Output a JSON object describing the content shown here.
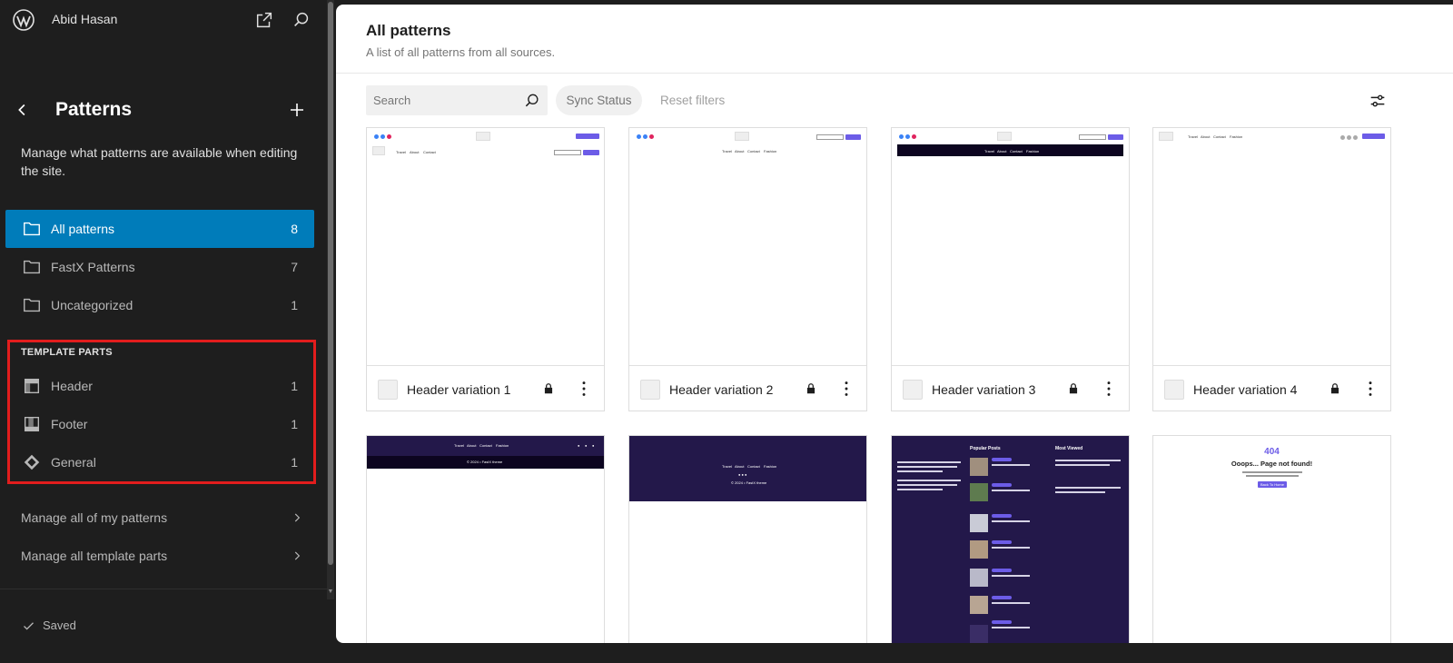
{
  "site": {
    "name": "Abid Hasan"
  },
  "sidebar": {
    "title": "Patterns",
    "description": "Manage what patterns are available when editing the site.",
    "nav": [
      {
        "label": "All patterns",
        "count": "8"
      },
      {
        "label": "FastX Patterns",
        "count": "7"
      },
      {
        "label": "Uncategorized",
        "count": "1"
      }
    ],
    "template_parts": {
      "heading": "TEMPLATE PARTS",
      "items": [
        {
          "label": "Header",
          "count": "1"
        },
        {
          "label": "Footer",
          "count": "1"
        },
        {
          "label": "General",
          "count": "1"
        }
      ]
    },
    "links": [
      {
        "label": "Manage all of my patterns"
      },
      {
        "label": "Manage all template parts"
      }
    ],
    "status": "Saved"
  },
  "main": {
    "title": "All patterns",
    "subtitle": "A list of all patterns from all sources.",
    "search_placeholder": "Search",
    "sync_status": "Sync Status",
    "reset": "Reset filters",
    "cards": [
      {
        "name": "Header variation 1"
      },
      {
        "name": "Header variation 2"
      },
      {
        "name": "Header variation 3"
      },
      {
        "name": "Header variation 4"
      }
    ],
    "preview_text": {
      "nav": [
        "Travel",
        "About",
        "Contact",
        "Fashion"
      ],
      "cta": "Subscribe",
      "search_btn": "search",
      "copyright": "© 2024 • FastX theme",
      "popular": "Popular Posts",
      "most_viewed": "Most Viewed",
      "e404": "404",
      "e404_title": "Ooops... Page not found!",
      "e404_btn": "Back To Home"
    }
  },
  "colors": {
    "accent": "#007cba",
    "highlight": "#e21d1d",
    "preview_dark": "#23184a",
    "preview_purple": "#6c5ce7"
  }
}
